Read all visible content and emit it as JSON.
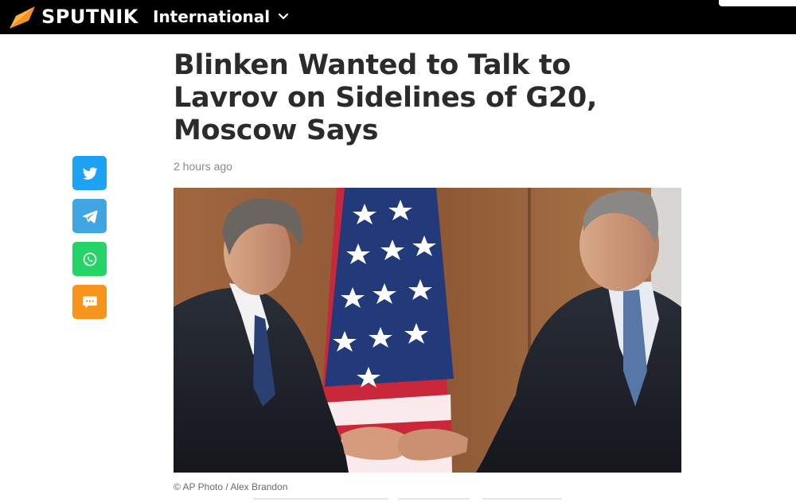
{
  "header": {
    "brand": "SPUTNIK",
    "edition": "International",
    "colors": {
      "bar": "#000000",
      "logo_accent": "#f7941d"
    }
  },
  "article": {
    "title": "Blinken Wanted to Talk to Lavrov on Sidelines of G20, Moscow Says",
    "published": "2 hours ago",
    "photo_credit": "© AP Photo / Alex Brandon"
  },
  "share": [
    {
      "icon": "twitter-icon",
      "color": "#1da1f2"
    },
    {
      "icon": "telegram-icon",
      "color": "#41a4e3"
    },
    {
      "icon": "whatsapp-icon",
      "color": "#25d366"
    },
    {
      "icon": "chat-icon",
      "color": "#f7941d"
    }
  ]
}
